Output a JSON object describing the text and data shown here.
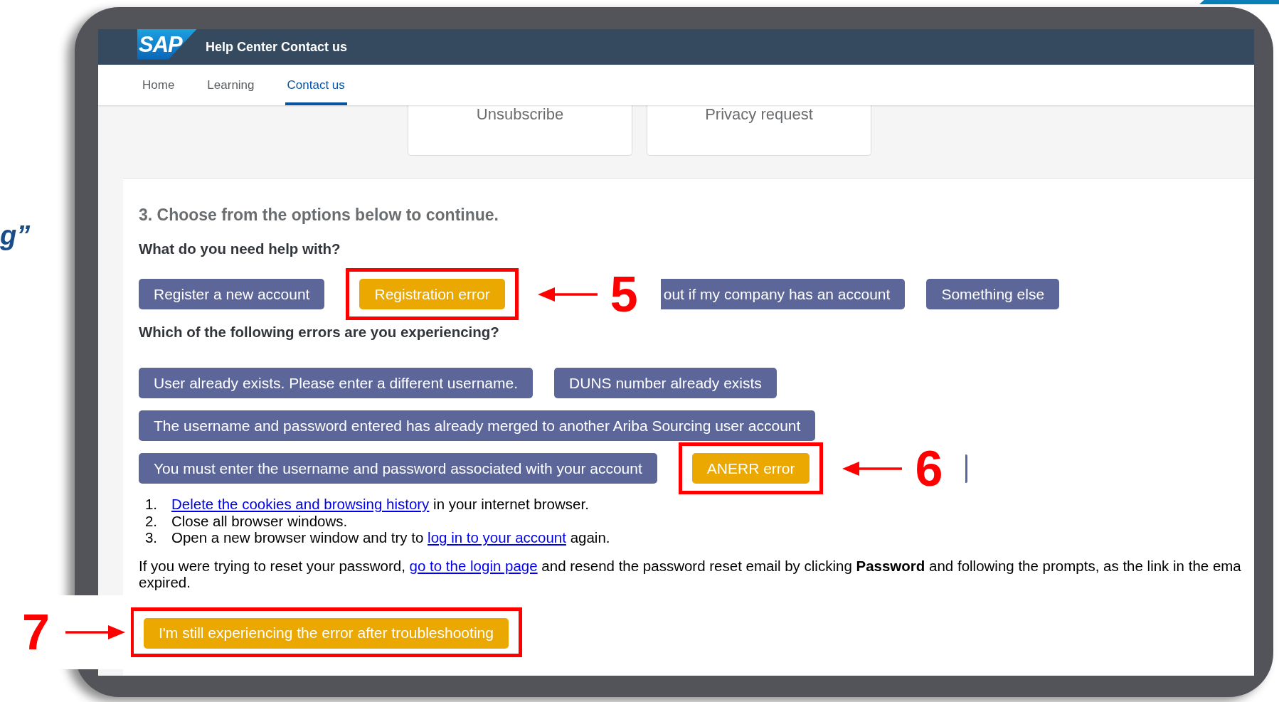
{
  "slide_text": "g”",
  "header": {
    "logo": "SAP",
    "title": "Help Center Contact us"
  },
  "nav": [
    {
      "label": "Home",
      "selected": false
    },
    {
      "label": "Learning",
      "selected": false
    },
    {
      "label": "Contact us",
      "selected": true
    }
  ],
  "cards": [
    "Unsubscribe",
    "Privacy request"
  ],
  "section": {
    "heading": "3. Choose from the options below to continue.",
    "question": "What do you need help with?",
    "options": [
      {
        "label": "Register a new account",
        "selected": false
      },
      {
        "label": "Registration error",
        "selected": true,
        "annotation": {
          "number": "5",
          "kind": "trailing"
        }
      },
      {
        "label": "out if my company has an account",
        "selected": false,
        "cut_left": true
      },
      {
        "label": "Something else",
        "selected": false
      }
    ],
    "errors_question": "Which of the following errors are you experiencing?",
    "error_rows": [
      [
        {
          "label": "User already exists. Please enter a different username.",
          "selected": false
        },
        {
          "label": "DUNS number already exists",
          "selected": false
        }
      ],
      [
        {
          "label": "The username and password entered has already merged to another Ariba Sourcing user account",
          "selected": false
        }
      ],
      [
        {
          "label": "You must enter the username and password associated with your account",
          "selected": false
        },
        {
          "label": "ANERR error",
          "selected": true,
          "annotation": {
            "number": "6",
            "kind": "trailing"
          }
        },
        {
          "selected": false,
          "partial": true
        }
      ]
    ],
    "steps": [
      {
        "number": "1.",
        "parts": [
          {
            "text": "Delete the cookies and browsing history",
            "link": true
          },
          {
            "text": " in your internet browser."
          }
        ]
      },
      {
        "number": "2.",
        "parts": [
          {
            "text": "Close all browser windows."
          }
        ]
      },
      {
        "number": "3.",
        "parts": [
          {
            "text": "Open a new browser window and try to "
          },
          {
            "text": "log in to your account",
            "link": true
          },
          {
            "text": " again."
          }
        ]
      }
    ],
    "note_lines": [
      [
        {
          "text": "If you were trying to reset your password, "
        },
        {
          "text": "go to the login page",
          "link": true
        },
        {
          "text": " and resend the password reset email by clicking **Password** and following the prompts, as the link in the ema"
        }
      ],
      [
        {
          "text": "expired."
        }
      ]
    ],
    "final_action": {
      "label": "I'm still experiencing the error after troubleshooting",
      "selected": true,
      "annotation": {
        "number": "7",
        "kind": "leading"
      }
    }
  }
}
